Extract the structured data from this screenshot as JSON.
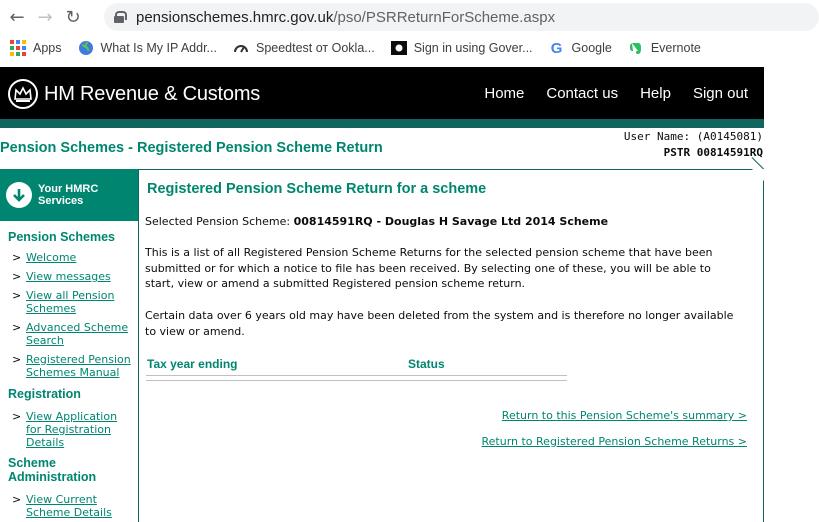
{
  "browser": {
    "url_host": "pensionschemes.hmrc.gov.uk",
    "url_path": "/pso/PSRReturnForScheme.aspx",
    "bookmarks": [
      {
        "label": "Apps",
        "icon": "apps-grid-icon"
      },
      {
        "label": "What Is My IP Addr...",
        "icon": "globe-icon"
      },
      {
        "label": "Speedtest от Ookla...",
        "icon": "speedometer-icon"
      },
      {
        "label": "Sign in using Gover...",
        "icon": "govuk-icon"
      },
      {
        "label": "Google",
        "icon": "google-icon"
      },
      {
        "label": "Evernote",
        "icon": "evernote-icon"
      }
    ]
  },
  "header": {
    "brand": "HM Revenue & Customs",
    "nav": [
      "Home",
      "Contact us",
      "Help",
      "Sign out"
    ]
  },
  "page": {
    "title": "Pension Schemes - Registered Pension Scheme Return",
    "user_name": "User Name: (A0145081)",
    "pstr": "PSTR 00814591RQ"
  },
  "sidebar": {
    "your_hmrc_line1": "Your HMRC",
    "your_hmrc_line2": "Services",
    "sections": [
      {
        "title": "Pension Schemes",
        "items": [
          [
            "Welcome"
          ],
          [
            "View messages"
          ],
          [
            "View all Pension",
            "Schemes"
          ],
          [
            "Advanced Scheme",
            "Search"
          ],
          [
            "Registered Pension",
            "Schemes Manual"
          ]
        ]
      },
      {
        "title": "Registration",
        "items": [
          [
            "View Application",
            "for Registration",
            "Details"
          ]
        ]
      },
      {
        "title_lines": [
          "Scheme",
          "Administration"
        ],
        "items": [
          [
            "View Current",
            "Scheme Details"
          ]
        ]
      }
    ]
  },
  "content": {
    "heading": "Registered Pension Scheme Return for a scheme",
    "selected_label": "Selected Pension Scheme:",
    "selected_value": "00814591RQ - Douglas H Savage Ltd 2014 Scheme",
    "para1_l1": "This is a list of all Registered Pension Scheme Returns for the selected pension scheme that have been",
    "para1_l2": "submitted or for which a notice to file has been received. By selecting one of these, you will be able to",
    "para1_l3": "start, view or amend a submitted Registered pension scheme return.",
    "para2_l1": "Certain data over 6 years old may have been deleted from the system and is therefore no longer available",
    "para2_l2": "to view or amend.",
    "col_tax_year": "Tax year ending",
    "col_status": "Status",
    "link_summary": "Return to this Pension Scheme's summary >",
    "link_returns": "Return to Registered Pension Scheme Returns >"
  },
  "colors": {
    "hmrc_green": "#008670",
    "header_black": "#000000",
    "teal_bar": "#10655f"
  }
}
